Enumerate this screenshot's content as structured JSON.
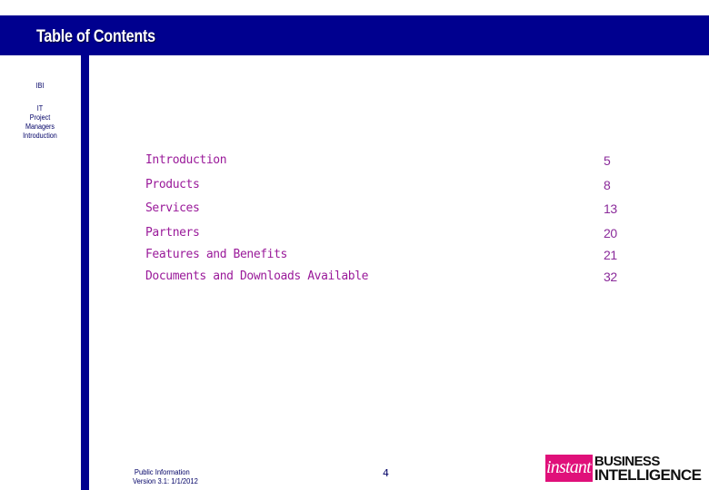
{
  "header": {
    "title": "Table of Contents"
  },
  "side_nav": {
    "items": [
      {
        "label": "IBI"
      },
      {
        "label": "IT"
      },
      {
        "label": "Project"
      },
      {
        "label": "Managers"
      },
      {
        "label": "Introduction"
      }
    ]
  },
  "toc": {
    "entries": [
      {
        "label": "Introduction",
        "page": "5"
      },
      {
        "label": "Products",
        "page": "8"
      },
      {
        "label": "Services",
        "page": "13"
      },
      {
        "label": "Partners",
        "page": "20"
      },
      {
        "label": "Features and Benefits",
        "page": "21"
      },
      {
        "label": "Documents and Downloads Available",
        "page": "32"
      }
    ]
  },
  "footer": {
    "classification": "Public Information",
    "version": "Version 3.1: 1/1/2012",
    "page_number": "4"
  },
  "logo": {
    "instant": "instant",
    "business": "BUSINESS",
    "intelligence": "INTELLIGENCE",
    "accent_color": "#e0107a"
  },
  "colors": {
    "header_bg": "#00008f",
    "toc_text": "#9a1a9a"
  }
}
